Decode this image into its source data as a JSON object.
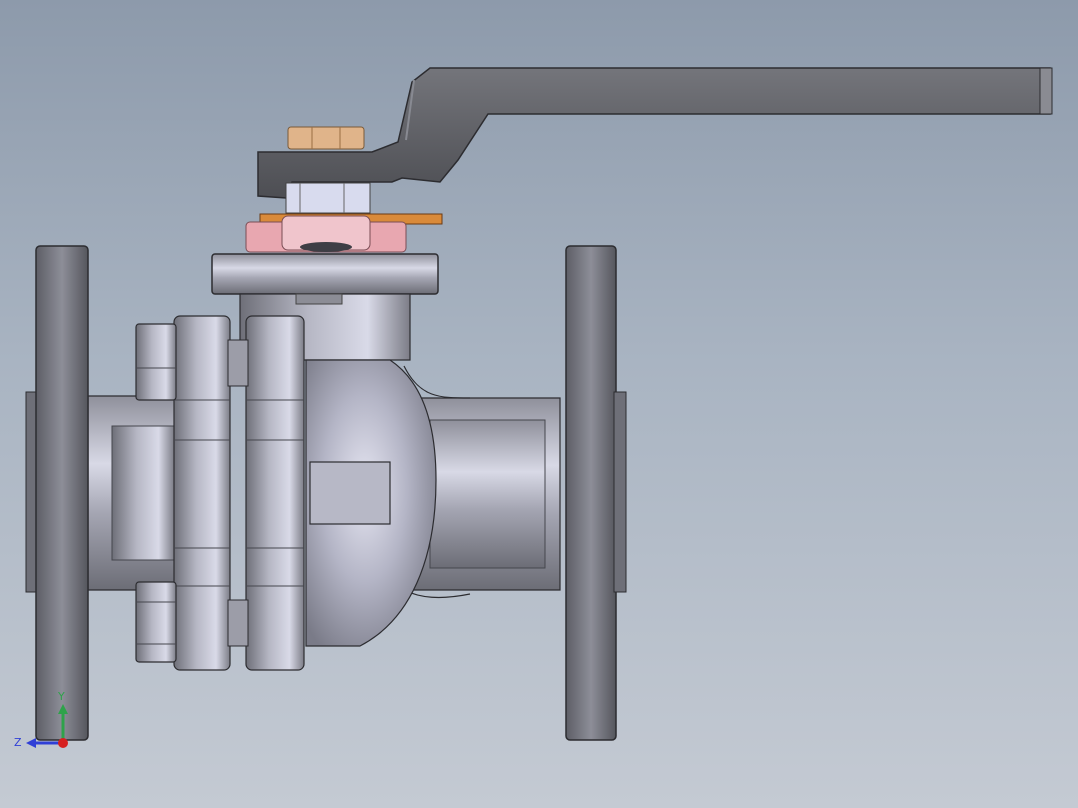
{
  "viewport": {
    "background_top": "#8d9aab",
    "background_bottom": "#c4cad3"
  },
  "model": {
    "body_color": "#b9bcc9",
    "handle_color": "#5f6066",
    "gland_color": "#e8a7b0",
    "washer_color": "#d98a3a",
    "nut_color": "#e0b48a",
    "stem_nut_color": "#d8dbee"
  },
  "triad": {
    "y_label": "Y",
    "z_label": "Z",
    "y_color": "#2ea24a",
    "z_color": "#2f3fd6",
    "x_color": "#d62020"
  }
}
